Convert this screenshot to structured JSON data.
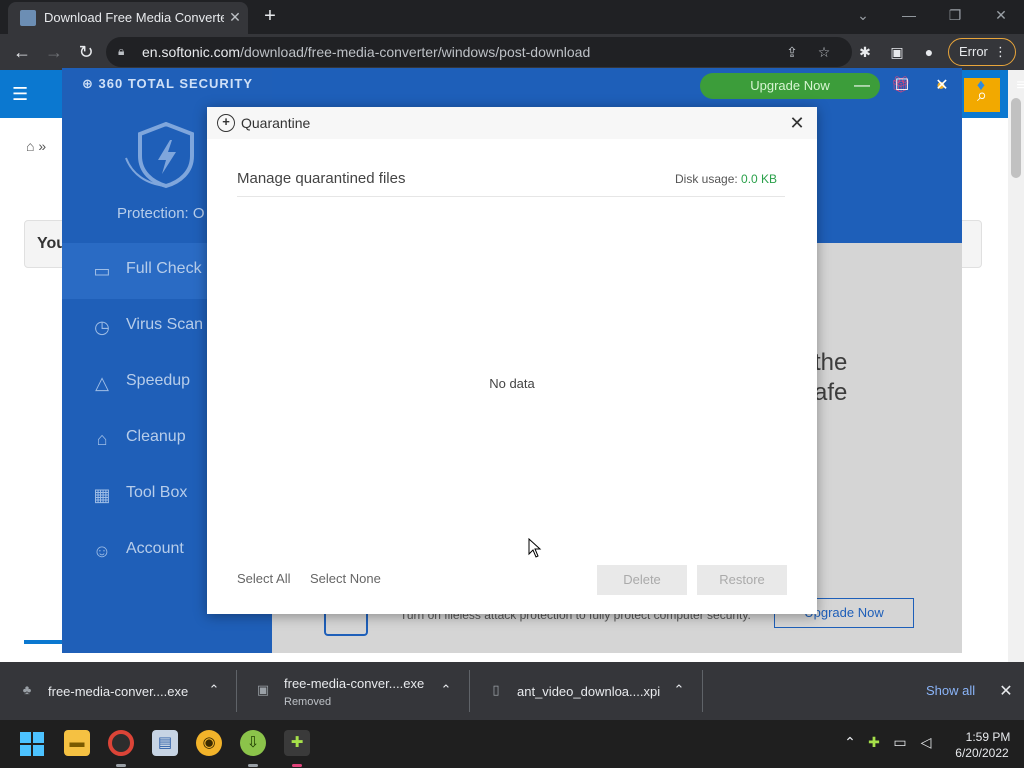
{
  "browser": {
    "tab_title": "Download Free Media Converter",
    "url_host": "en.softonic.com",
    "url_path": "/download/free-media-converter/windows/post-download",
    "error_label": "Error"
  },
  "page": {
    "behind_text_1": "You",
    "behind_text_2": "the",
    "behind_text_3": "afe"
  },
  "app": {
    "logo": "360 TOTAL SECURITY",
    "protection_label": "Protection: O",
    "upgrade_label": "Upgrade Now",
    "sidebar": [
      {
        "label": "Full Check",
        "icon": "monitor-icon"
      },
      {
        "label": "Virus Scan",
        "icon": "virus-scan-icon"
      },
      {
        "label": "Speedup",
        "icon": "rocket-icon"
      },
      {
        "label": "Cleanup",
        "icon": "broom-icon"
      },
      {
        "label": "Tool Box",
        "icon": "toolbox-icon"
      },
      {
        "label": "Account",
        "icon": "account-icon"
      }
    ],
    "bottom_text": "Turn on fileless attack protection to fully protect computer security.",
    "bottom_button": "Upgrade Now"
  },
  "dialog": {
    "title": "Quarantine",
    "heading": "Manage quarantined files",
    "disk_label": "Disk usage: ",
    "disk_value": "0.0 KB",
    "empty": "No data",
    "select_all": "Select All",
    "select_none": "Select None",
    "delete": "Delete",
    "restore": "Restore"
  },
  "downloads": [
    {
      "name": "free-media-conver....exe",
      "status": ""
    },
    {
      "name": "free-media-conver....exe",
      "status": "Removed"
    },
    {
      "name": "ant_video_downloa....xpi",
      "status": ""
    }
  ],
  "downloads_bar": {
    "show_all": "Show all"
  },
  "taskbar": {
    "time": "1:59 PM",
    "date": "6/20/2022"
  }
}
